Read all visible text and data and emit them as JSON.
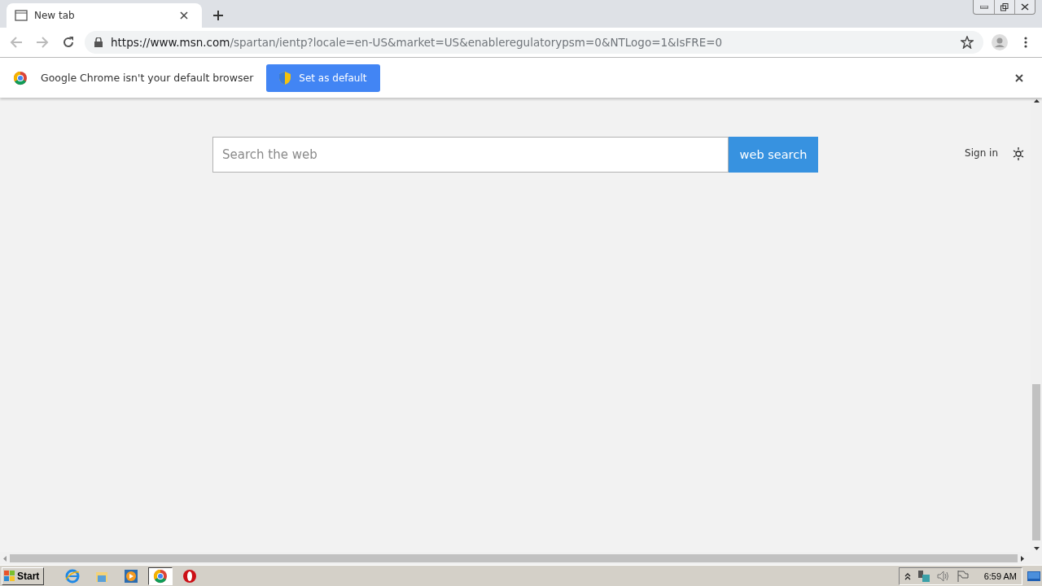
{
  "tabs": [
    {
      "title": "New tab",
      "selected": true
    }
  ],
  "address_bar": {
    "host": "https://www.msn.com",
    "path": "/spartan/ientp?locale=en-US&market=US&enableregulatorypsm=0&NTLogo=1&IsFRE=0"
  },
  "infobar": {
    "message": "Google Chrome isn't your default browser",
    "button": "Set as default"
  },
  "search": {
    "placeholder": "Search the web",
    "button": "web search"
  },
  "sign_in": "Sign in",
  "taskbar": {
    "start": "Start",
    "apps": [
      {
        "kind": "ie",
        "selected": false
      },
      {
        "kind": "folder",
        "selected": false
      },
      {
        "kind": "media",
        "selected": false
      },
      {
        "kind": "chrome",
        "selected": true
      },
      {
        "kind": "opera",
        "selected": false
      }
    ],
    "clock": "6:59 AM"
  }
}
